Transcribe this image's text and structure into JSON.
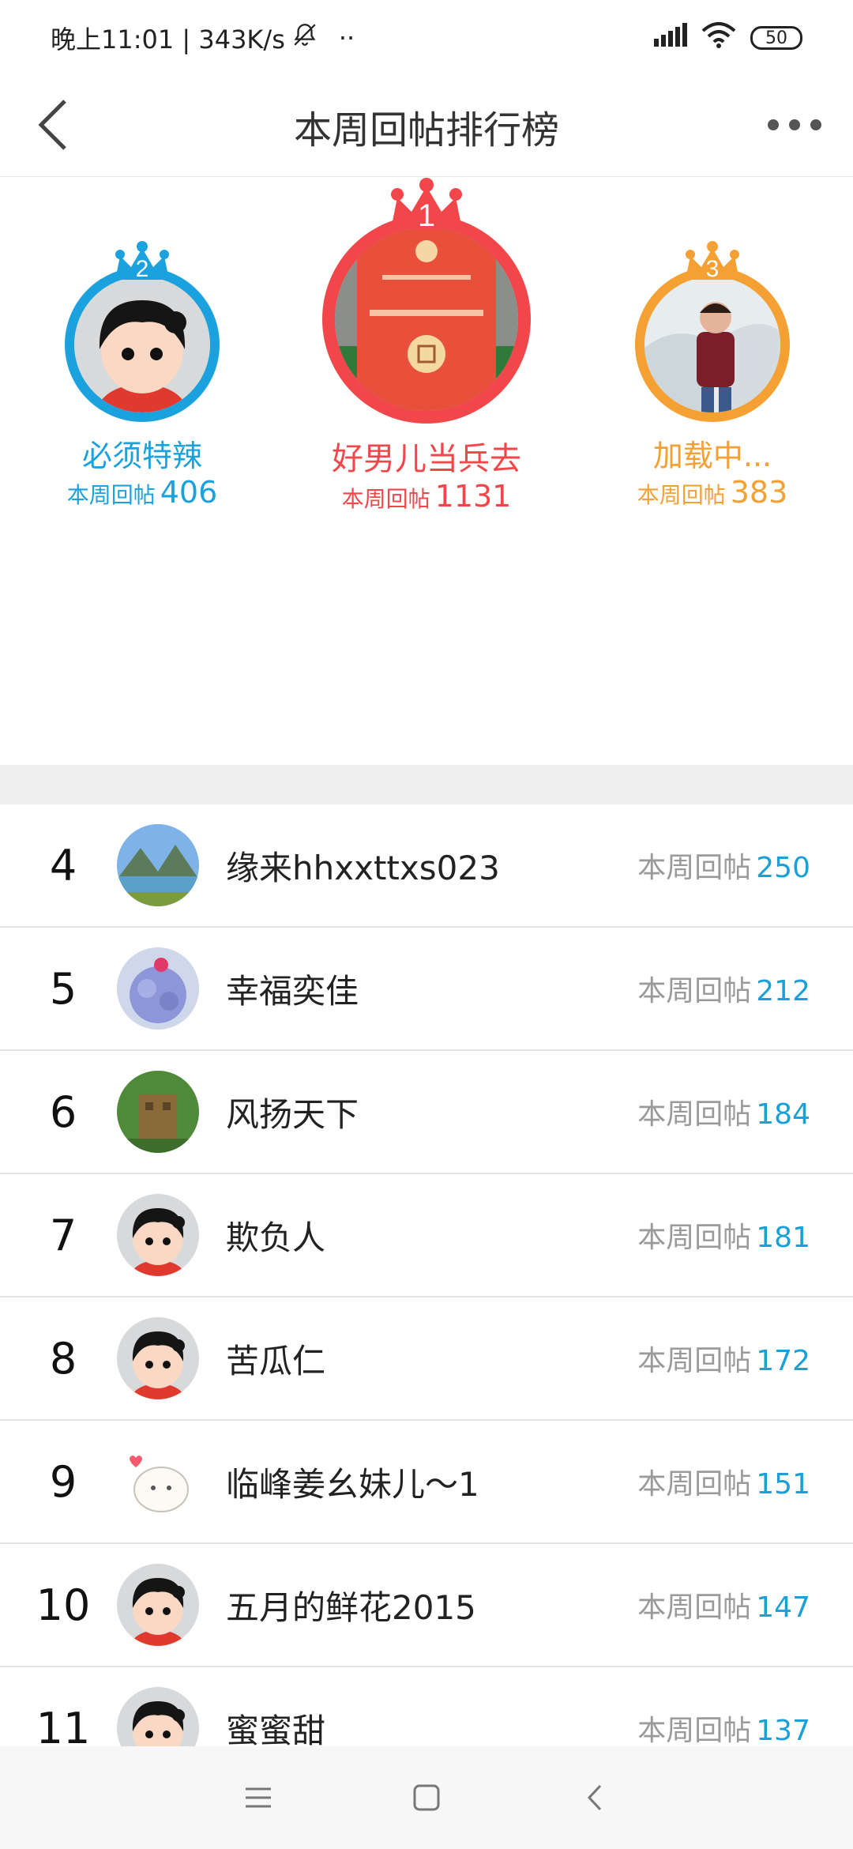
{
  "status_bar": {
    "time_text": "晚上11:01 | 343K/s",
    "dots": "··",
    "battery": "50"
  },
  "header": {
    "title": "本周回帖排行榜"
  },
  "podium": {
    "first": {
      "rank": "1",
      "name": "好男儿当兵去",
      "label": "本周回帖",
      "count": "1131",
      "color": "#f2474a"
    },
    "second": {
      "rank": "2",
      "name": "必须特辣",
      "label": "本周回帖",
      "count": "406",
      "color": "#1ba2de"
    },
    "third": {
      "rank": "3",
      "name": "加载中...",
      "label": "本周回帖",
      "count": "383",
      "color": "#f5a033"
    }
  },
  "ranking": [
    {
      "rank": "4",
      "name": "缘来hhxxttxs023",
      "label": "本周回帖",
      "count": "250"
    },
    {
      "rank": "5",
      "name": "幸福奕佳",
      "label": "本周回帖",
      "count": "212"
    },
    {
      "rank": "6",
      "name": "风扬天下",
      "label": "本周回帖",
      "count": "184"
    },
    {
      "rank": "7",
      "name": "欺负人",
      "label": "本周回帖",
      "count": "181"
    },
    {
      "rank": "8",
      "name": "苦瓜仁",
      "label": "本周回帖",
      "count": "172"
    },
    {
      "rank": "9",
      "name": "临峰姜幺妹儿～1",
      "label": "本周回帖",
      "count": "151"
    },
    {
      "rank": "10",
      "name": "五月的鲜花2015",
      "label": "本周回帖",
      "count": "147"
    },
    {
      "rank": "11",
      "name": "蜜蜜甜",
      "label": "本周回帖",
      "count": "137"
    }
  ],
  "colors": {
    "count_blue": "#1aa0d8",
    "gray_label": "#9a9a9a"
  }
}
